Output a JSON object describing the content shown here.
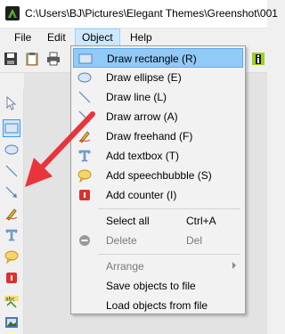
{
  "window": {
    "title": "C:\\Users\\BJ\\Pictures\\Elegant Themes\\Greenshot\\001"
  },
  "menubar": {
    "file_label": "File",
    "edit_label": "Edit",
    "object_label": "Object",
    "help_label": "Help"
  },
  "object_menu": {
    "items": [
      {
        "label": "Draw rectangle (R)",
        "icon": "rectangle-icon"
      },
      {
        "label": "Draw ellipse (E)",
        "icon": "ellipse-icon"
      },
      {
        "label": "Draw line (L)",
        "icon": "line-icon"
      },
      {
        "label": "Draw arrow (A)",
        "icon": "arrow-icon"
      },
      {
        "label": "Draw freehand (F)",
        "icon": "freehand-icon"
      },
      {
        "label": "Add textbox (T)",
        "icon": "textbox-icon"
      },
      {
        "label": "Add speechbubble (S)",
        "icon": "speechbubble-icon"
      },
      {
        "label": "Add counter (I)",
        "icon": "counter-icon"
      },
      {
        "label": "Select all",
        "shortcut": "Ctrl+A"
      },
      {
        "label": "Delete",
        "shortcut": "Del",
        "icon": "delete-icon"
      },
      {
        "label": "Arrange"
      },
      {
        "label": "Save objects to file"
      },
      {
        "label": "Load objects from file"
      }
    ]
  },
  "colors": {
    "menu_highlight": "#91c9f7",
    "annotation_arrow": "#e8343b"
  }
}
